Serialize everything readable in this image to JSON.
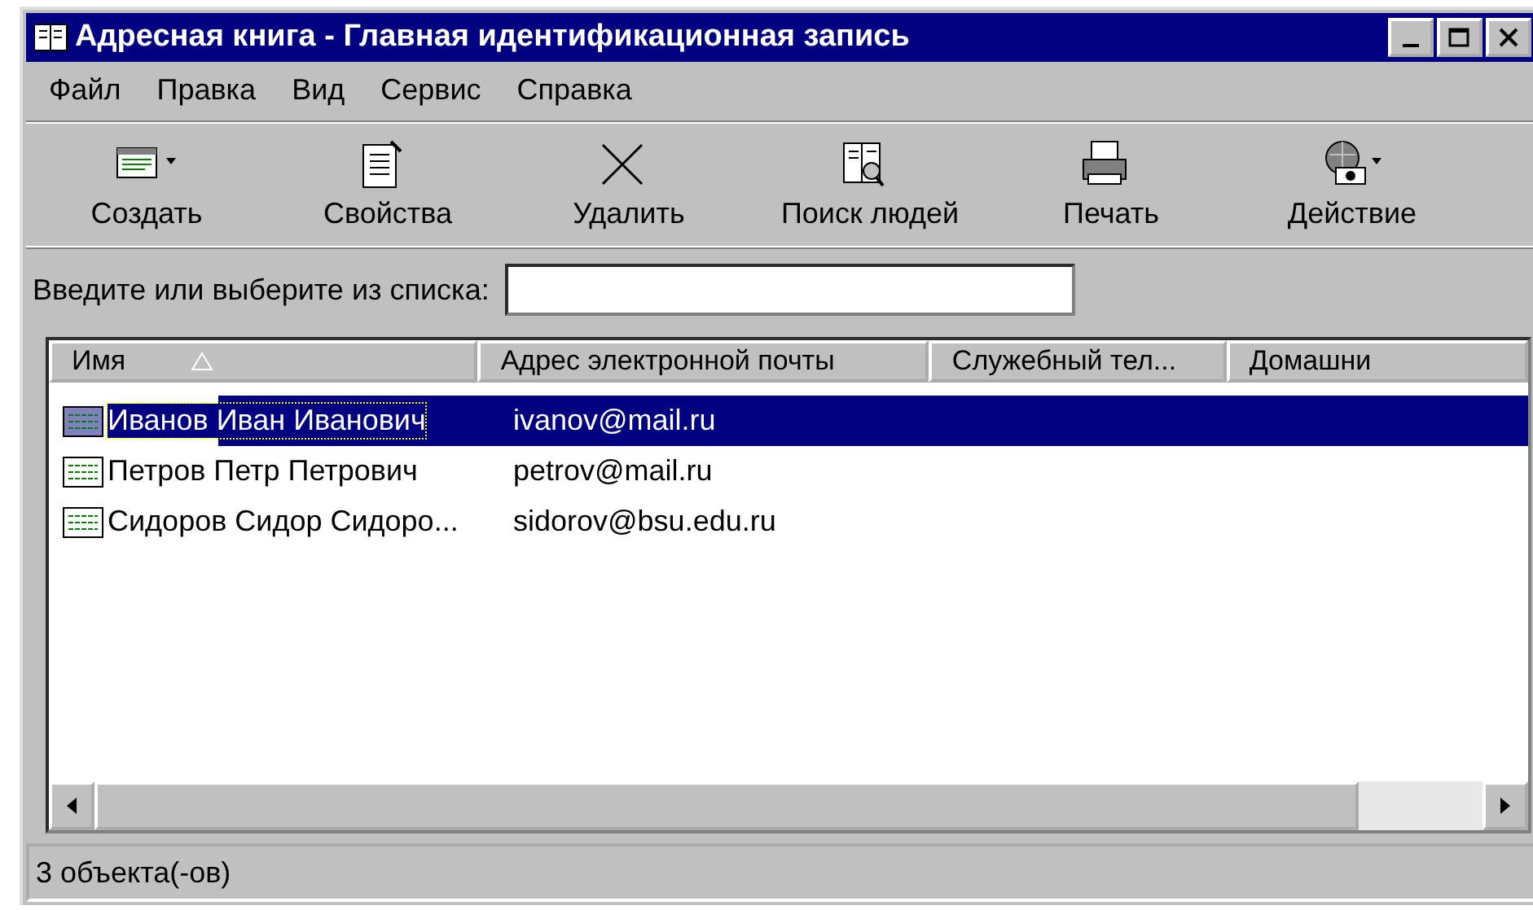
{
  "window": {
    "title": "Адресная книга - Главная идентификационная запись"
  },
  "menu": [
    {
      "label": "Файл"
    },
    {
      "label": "Правка"
    },
    {
      "label": "Вид"
    },
    {
      "label": "Сервис"
    },
    {
      "label": "Справка"
    }
  ],
  "toolbar": [
    {
      "label": "Создать",
      "kind": "card",
      "dropdown": true
    },
    {
      "label": "Свойства",
      "kind": "properties",
      "dropdown": false
    },
    {
      "label": "Удалить",
      "kind": "delete",
      "dropdown": false
    },
    {
      "label": "Поиск людей",
      "kind": "find",
      "dropdown": false
    },
    {
      "label": "Печать",
      "kind": "print",
      "dropdown": false
    },
    {
      "label": "Действие",
      "kind": "action",
      "dropdown": true
    }
  ],
  "search": {
    "label": "Введите или выберите из списка:"
  },
  "table": {
    "columns": [
      {
        "label": "Имя",
        "sorted": true
      },
      {
        "label": "Адрес электронной почты",
        "sorted": false
      },
      {
        "label": "Служебный тел...",
        "sorted": false
      },
      {
        "label": "Домашни",
        "sorted": false
      }
    ],
    "rows": [
      {
        "name": "Иванов Иван Иванович",
        "email": "ivanov@mail.ru",
        "selected": true
      },
      {
        "name": "Петров Петр Петрович",
        "email": "petrov@mail.ru",
        "selected": false
      },
      {
        "name": "Сидоров Сидор Сидоро...",
        "email": "sidorov@bsu.edu.ru",
        "selected": false
      }
    ]
  },
  "status_bar": "3 объекта(-ов)"
}
